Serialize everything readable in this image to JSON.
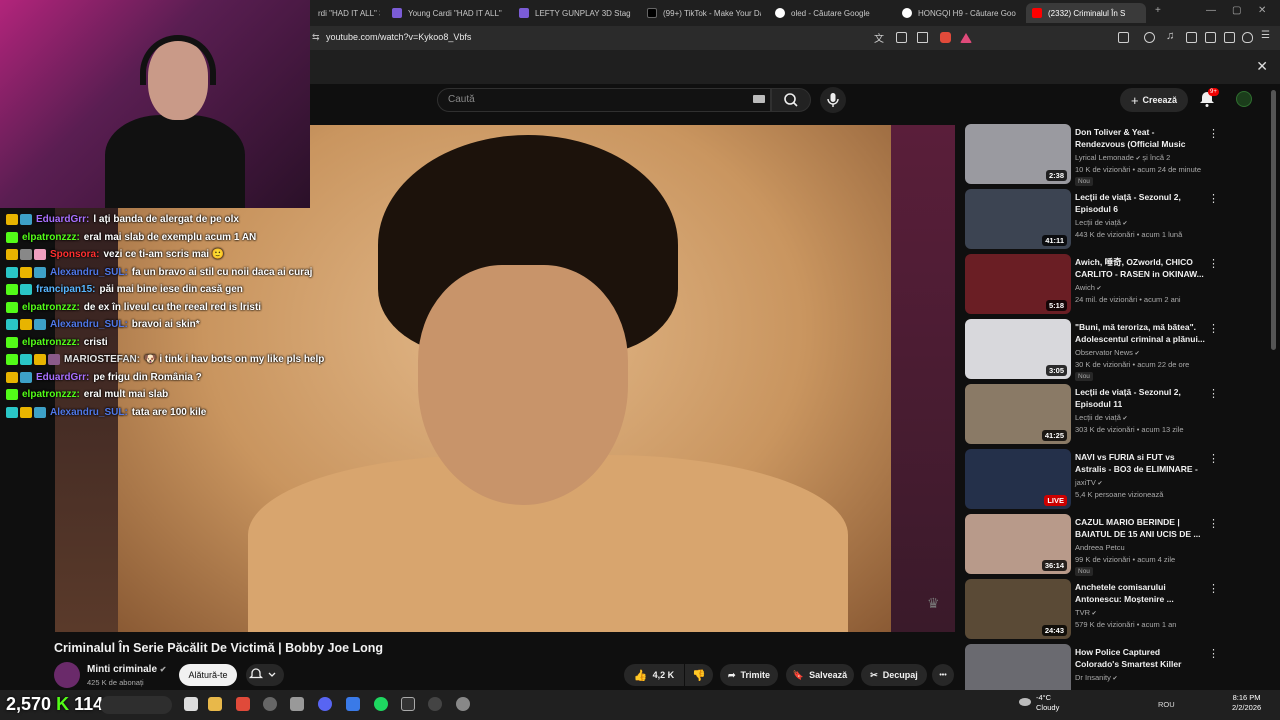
{
  "browser": {
    "tabs": [
      {
        "label": "rdi \"HAD IT ALL\" 3D",
        "color": "#ffffff"
      },
      {
        "label": "Young Cardi \"HAD IT ALL\" 3D",
        "color": "#7b5cd6"
      },
      {
        "label": "LEFTY GUNPLAY 3D Stage V",
        "color": "#7b5cd6"
      },
      {
        "label": "(99+) TikTok - Make Your Day",
        "color": "#000000"
      },
      {
        "label": "oled - Căutare Google",
        "color": "#ffffff"
      },
      {
        "label": "HONGQI H9 - Căutare Goo",
        "color": "#ffffff"
      },
      {
        "label": "(2332) Criminalul În S",
        "color": "#ff0000"
      }
    ],
    "new_tab": "+",
    "url": "youtube.com/watch?v=Kykoo8_Vbfs",
    "close": "✕"
  },
  "youtube": {
    "search_placeholder": "Caută",
    "create_label": "Creează",
    "notifications_badge": "9+",
    "video": {
      "title": "Criminalul În Serie Păcălit De Victimă | Bobby Joe Long",
      "channel": "Minti criminale",
      "subscribers": "425 K de abonați",
      "join_label": "Alătură-te",
      "likes": "4,2 K",
      "share_label": "Trimite",
      "save_label": "Salvează",
      "clip_label": "Decupaj",
      "more": "•••"
    },
    "recommendations": [
      {
        "title": "Don Toliver & Yeat - Rendezvous (Official Music Video)",
        "channel": "Lyrical Lemonade",
        "channel_extra": "și încă 2",
        "meta": "10 K de vizionări • acum 24 de minute",
        "duration": "2:38",
        "new": "Nou",
        "thumb": "#9a9aa0",
        "verified": true
      },
      {
        "title": "Lecții de viață - Sezonul 2, Episodul 6",
        "channel": "Lecții de viață",
        "channel_extra": "",
        "meta": "443 K de vizionări • acum 1 lună",
        "duration": "41:11",
        "new": "",
        "thumb": "#3c4452",
        "verified": true
      },
      {
        "title": "Awich, 唾奇, OZworld, CHICO CARLITO - RASEN in OKINAW...",
        "channel": "Awich",
        "channel_extra": "",
        "meta": "24 mil. de vizionări • acum 2 ani",
        "duration": "5:18",
        "new": "",
        "thumb": "#6a1e24",
        "verified": true
      },
      {
        "title": "\"Buni, mă teroriza, mă bătea\". Adolescentul criminal a plănui...",
        "channel": "Observator News",
        "channel_extra": "",
        "meta": "30 K de vizionări • acum 22 de ore",
        "duration": "3:05",
        "new": "Nou",
        "thumb": "#d8d8dc",
        "verified": true
      },
      {
        "title": "Lecții de viață - Sezonul 2, Episodul 11",
        "channel": "Lecții de viață",
        "channel_extra": "",
        "meta": "303 K de vizionări • acum 13 zile",
        "duration": "41:25",
        "new": "",
        "thumb": "#8a7a66",
        "verified": true
      },
      {
        "title": "NAVI vs FURIA si FUT vs Astralis - BO3 de ELIMINARE - ...",
        "channel": "jaxiTV",
        "channel_extra": "",
        "meta": "5,4 K persoane vizionează",
        "duration": "LIVE",
        "new": "",
        "thumb": "#24304a",
        "verified": true
      },
      {
        "title": "CAZUL MARIO BERINDE | BAIATUL DE 15 ANI UCIS DE ...",
        "channel": "Andreea Petcu",
        "channel_extra": "",
        "meta": "99 K de vizionări • acum 4 zile",
        "duration": "36:14",
        "new": "Nou",
        "thumb": "#b89a8a",
        "verified": false
      },
      {
        "title": "Anchetele comisarului Antonescu: Moștenire ...",
        "channel": "TVR",
        "channel_extra": "",
        "meta": "579 K de vizionări • acum 1 an",
        "duration": "24:43",
        "new": "",
        "thumb": "#5a4a36",
        "verified": true
      },
      {
        "title": "How Police Captured Colorado's Smartest Killer",
        "channel": "Dr Insanity",
        "channel_extra": "",
        "meta": "",
        "duration": "",
        "new": "",
        "thumb": "#6a6a70",
        "verified": true
      }
    ]
  },
  "chat": [
    {
      "user": "EduardGrr:",
      "text": "l ați banda de alergat de pe olx",
      "color": "#a970ff",
      "badges": [
        "#e8b400",
        "#3da1c7"
      ]
    },
    {
      "user": "elpatronzzz:",
      "text": "eral mai slab de exemplu acum 1 AN",
      "color": "#53fc18",
      "badges": [
        "#53fc18"
      ]
    },
    {
      "user": "Sponsora:",
      "text": "vezi ce ti-am scris mai 🙂",
      "color": "#ff3030",
      "badges": [
        "#e8b400",
        "#888888",
        "#f0a0c0"
      ]
    },
    {
      "user": "Alexandru_SUL:",
      "text": "fa un bravo ai stil cu noii daca ai curaj",
      "color": "#5078e8",
      "badges": [
        "#2ac7c7",
        "#e8b400",
        "#3da1c7"
      ]
    },
    {
      "user": "francipan15:",
      "text": "păi mai bine iese din casă gen",
      "color": "#58b6ff",
      "badges": [
        "#53fc18",
        "#2ac7c7"
      ]
    },
    {
      "user": "elpatronzzz:",
      "text": "de ex în liveul cu the reeal red is lristi",
      "color": "#53fc18",
      "badges": [
        "#53fc18"
      ]
    },
    {
      "user": "Alexandru_SUL:",
      "text": "bravoi ai skin*",
      "color": "#5078e8",
      "badges": [
        "#2ac7c7",
        "#e8b400",
        "#3da1c7"
      ]
    },
    {
      "user": "elpatronzzz:",
      "text": "cristi",
      "color": "#53fc18",
      "badges": [
        "#53fc18"
      ]
    },
    {
      "user": "MARIOSTEFAN:",
      "text": "🐶 i tink i hav bots on my like pls help",
      "color": "#e6e6e6",
      "badges": [
        "#53fc18",
        "#2ac7c7",
        "#e8b400",
        "#8a5a8a"
      ]
    },
    {
      "user": "EduardGrr:",
      "text": "pe frigu din România ?",
      "color": "#a970ff",
      "badges": [
        "#e8b400",
        "#3da1c7"
      ]
    },
    {
      "user": "elpatronzzz:",
      "text": "eral mult mai slab",
      "color": "#53fc18",
      "badges": [
        "#53fc18"
      ]
    },
    {
      "user": "Alexandru_SUL:",
      "text": "tata are 100 kile",
      "color": "#5078e8",
      "badges": [
        "#2ac7c7",
        "#e8b400",
        "#3da1c7"
      ]
    }
  ],
  "overlay_stats": {
    "viewers": "2,570",
    "followers": "114"
  },
  "taskbar": {
    "weather_temp": "-4°C",
    "weather_desc": "Cloudy",
    "lang": "ROU",
    "time": "8:16 PM",
    "date": "2/2/2026"
  }
}
